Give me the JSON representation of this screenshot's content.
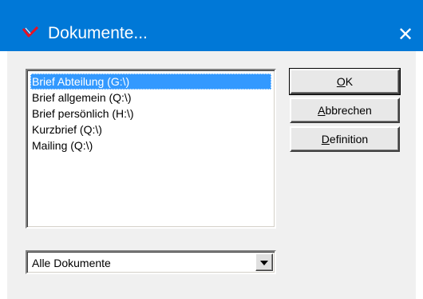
{
  "window": {
    "title": "Dokumente...",
    "close_glyph": "✕",
    "title_icon": "red-check-icon",
    "accent_color": "#0078d7"
  },
  "list": {
    "items": [
      {
        "label": "Brief Abteilung (G:\\)",
        "selected": true
      },
      {
        "label": "Brief allgemein (Q:\\)",
        "selected": false
      },
      {
        "label": "Brief persönlich (H:\\)",
        "selected": false
      },
      {
        "label": "Kurzbrief (Q:\\)",
        "selected": false
      },
      {
        "label": "Mailing (Q:\\)",
        "selected": false
      }
    ],
    "selection_color": "#3399ff"
  },
  "filter": {
    "selected_value": "Alle Dokumente"
  },
  "buttons": {
    "ok": {
      "mnemonic": "O",
      "rest": "K"
    },
    "cancel": {
      "mnemonic": "A",
      "rest": "bbrechen"
    },
    "definition": {
      "mnemonic": "D",
      "rest": "efinition"
    }
  }
}
